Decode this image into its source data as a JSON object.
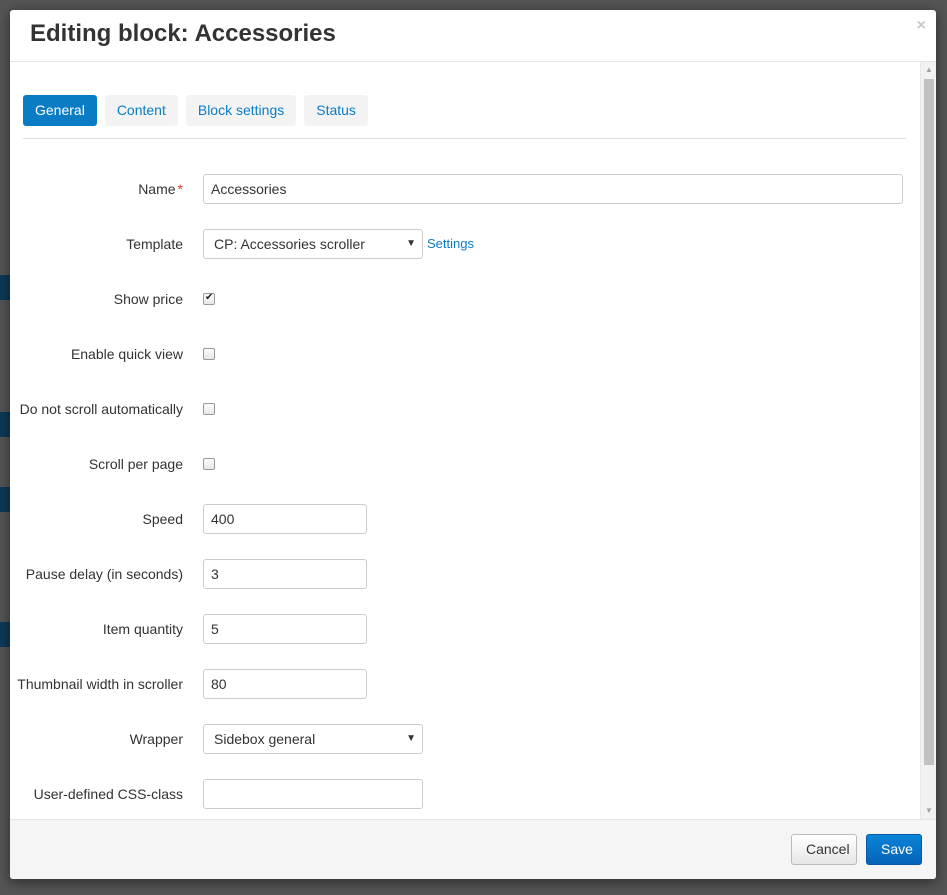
{
  "modal": {
    "title": "Editing block: Accessories",
    "close_label": "×"
  },
  "tabs": [
    {
      "label": "General",
      "active": true
    },
    {
      "label": "Content",
      "active": false
    },
    {
      "label": "Block settings",
      "active": false
    },
    {
      "label": "Status",
      "active": false
    }
  ],
  "form": {
    "name": {
      "label": "Name",
      "required_mark": "*",
      "value": "Accessories"
    },
    "template": {
      "label": "Template",
      "selected": "CP: Accessories scroller",
      "settings_link": "Settings"
    },
    "show_price": {
      "label": "Show price",
      "checked": true
    },
    "enable_quick_view": {
      "label": "Enable quick view",
      "checked": false
    },
    "do_not_scroll": {
      "label": "Do not scroll automatically",
      "checked": false
    },
    "scroll_per_page": {
      "label": "Scroll per page",
      "checked": false
    },
    "speed": {
      "label": "Speed",
      "value": "400"
    },
    "pause_delay": {
      "label": "Pause delay (in seconds)",
      "value": "3"
    },
    "item_quantity": {
      "label": "Item quantity",
      "value": "5"
    },
    "thumbnail_width": {
      "label": "Thumbnail width in scroller",
      "value": "80"
    },
    "wrapper": {
      "label": "Wrapper",
      "selected": "Sidebox general"
    },
    "css_class": {
      "label": "User-defined CSS-class",
      "value": ""
    }
  },
  "footer": {
    "cancel_label": "Cancel",
    "save_label": "Save"
  },
  "colors": {
    "accent": "#0a7cc4",
    "save_button": "#0663b8"
  }
}
